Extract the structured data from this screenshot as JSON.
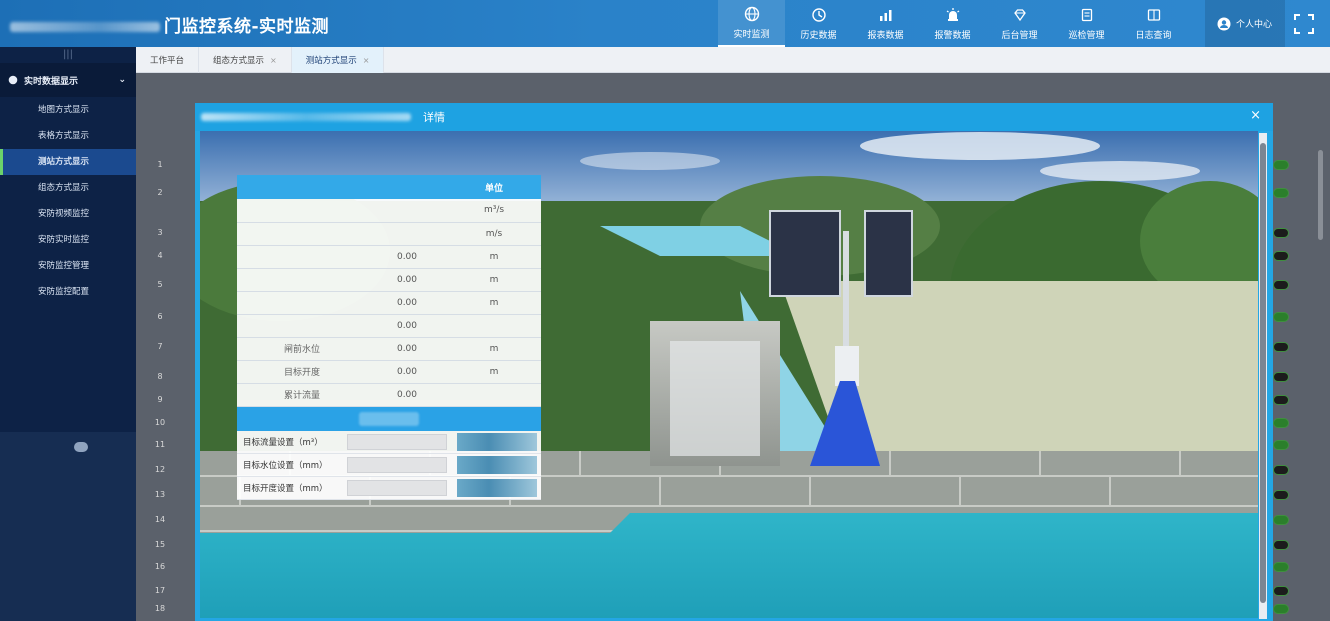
{
  "header": {
    "title": "门监控系统-实时监测",
    "nav": [
      {
        "label": "实时监测",
        "icon": "globe-icon",
        "active": true
      },
      {
        "label": "历史数据",
        "icon": "history-icon",
        "active": false
      },
      {
        "label": "报表数据",
        "icon": "chart-icon",
        "active": false
      },
      {
        "label": "报警数据",
        "icon": "alarm-icon",
        "active": false
      },
      {
        "label": "后台管理",
        "icon": "diamond-icon",
        "active": false
      },
      {
        "label": "巡检管理",
        "icon": "clipboard-icon",
        "active": false
      },
      {
        "label": "日志查询",
        "icon": "log-icon",
        "active": false
      }
    ],
    "user_label": "个人中心"
  },
  "sidebar": {
    "group": "实时数据显示",
    "items": [
      {
        "label": "地图方式显示",
        "active": false
      },
      {
        "label": "表格方式显示",
        "active": false
      },
      {
        "label": "测站方式显示",
        "active": true
      },
      {
        "label": "组态方式显示",
        "active": false
      },
      {
        "label": "安防视频监控",
        "active": false
      },
      {
        "label": "安防实时监控",
        "active": false
      },
      {
        "label": "安防监控管理",
        "active": false
      },
      {
        "label": "安防监控配置",
        "active": false
      }
    ]
  },
  "tabs": [
    {
      "label": "工作平台",
      "closable": false,
      "active": false
    },
    {
      "label": "组态方式显示",
      "closable": true,
      "active": false
    },
    {
      "label": "测站方式显示",
      "closable": true,
      "active": true
    }
  ],
  "main": {
    "rows": [
      "1",
      "2",
      "3",
      "4",
      "5",
      "6",
      "7",
      "8",
      "9",
      "10",
      "11",
      "12",
      "13",
      "14",
      "15",
      "16",
      "17",
      "18"
    ]
  },
  "modal": {
    "title": "详情",
    "close": "×",
    "table": {
      "headers": [
        "",
        "",
        "单位"
      ],
      "rows": [
        {
          "name": "",
          "value": "",
          "unit": "m³/s"
        },
        {
          "name": "",
          "value": "",
          "unit": "m/s"
        },
        {
          "name": "",
          "value": "0.00",
          "unit": "m"
        },
        {
          "name": "",
          "value": "0.00",
          "unit": "m"
        },
        {
          "name": "",
          "value": "0.00",
          "unit": "m"
        },
        {
          "name": "",
          "value": "0.00",
          "unit": ""
        },
        {
          "name": "闸前水位",
          "value": "0.00",
          "unit": "m"
        },
        {
          "name": "目标开度",
          "value": "0.00",
          "unit": "m"
        },
        {
          "name": "累计流量",
          "value": "0.00",
          "unit": ""
        }
      ]
    },
    "settings": [
      {
        "label": "目标流量设置（m³）",
        "value": ""
      },
      {
        "label": "目标水位设置（mm）",
        "value": ""
      },
      {
        "label": "目标开度设置（mm）",
        "value": ""
      }
    ]
  },
  "colors": {
    "header": "#2a82c9",
    "sidebar": "#0d2246",
    "accent_blue": "#24a6e4",
    "active_marker": "#6bd36b"
  }
}
